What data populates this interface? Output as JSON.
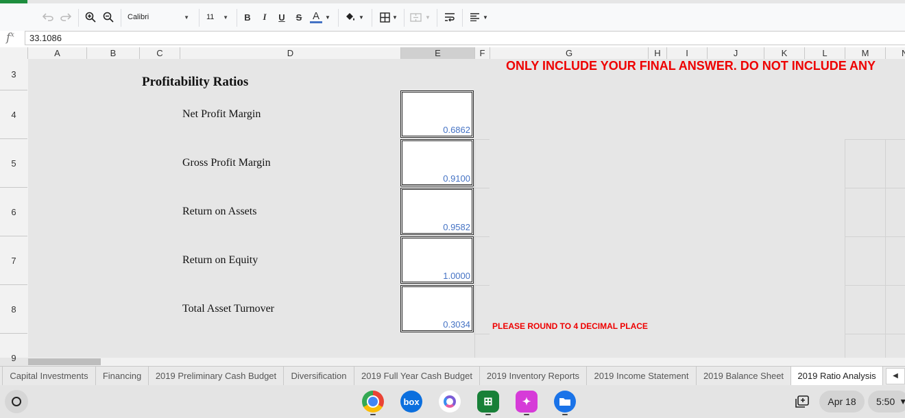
{
  "toolbar": {
    "font_name": "Calibri",
    "font_size": "11",
    "bold": "B",
    "italic": "I",
    "underline": "U",
    "strike": "S",
    "text_color_glyph": "A"
  },
  "formula_bar": {
    "fx_label": "fx",
    "value": "33.1086"
  },
  "columns": [
    "A",
    "B",
    "C",
    "D",
    "E",
    "F",
    "G",
    "H",
    "I",
    "J",
    "K",
    "L",
    "M",
    "N"
  ],
  "rows": [
    "3",
    "4",
    "5",
    "6",
    "7",
    "8",
    "9"
  ],
  "sheet": {
    "title": "Profitability Ratios",
    "warning": "ONLY INCLUDE YOUR FINAL ANSWER. DO NOT INCLUDE ANY",
    "round_note": "PLEASE ROUND TO 4 DECIMAL PLACE",
    "ratios": [
      {
        "label": "Net Profit Margin",
        "value": "0.6862"
      },
      {
        "label": "Gross Profit Margin",
        "value": "0.9100"
      },
      {
        "label": "Return on Assets",
        "value": "0.9582"
      },
      {
        "label": "Return on Equity",
        "value": "1.0000"
      },
      {
        "label": "Total Asset Turnover",
        "value": "0.3034"
      }
    ]
  },
  "tabs": [
    "Capital Investments",
    "Financing",
    "2019 Preliminary Cash Budget",
    "Diversification",
    "2019 Full Year Cash Budget",
    "2019 Inventory Reports",
    "2019 Income Statement",
    "2019 Balance Sheet",
    "2019 Ratio Analysis"
  ],
  "active_tab": "2019 Ratio Analysis",
  "shelf": {
    "date": "Apr 18",
    "time": "5:50",
    "box_label": "box"
  },
  "colors": {
    "accent_green": "#1e8e3e",
    "value_blue": "#4472c4",
    "warning_red": "#ee0000"
  }
}
